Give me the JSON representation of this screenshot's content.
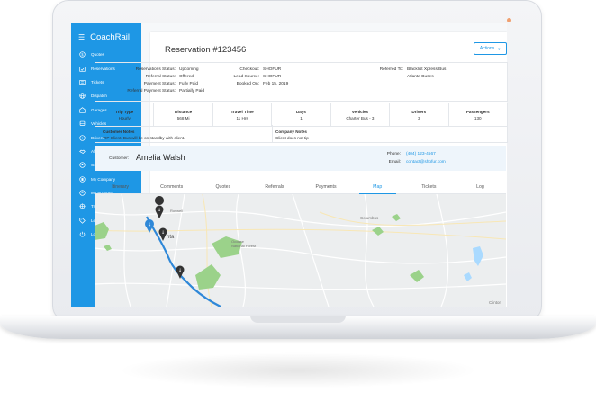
{
  "app": {
    "name": "CoachRail"
  },
  "sidebar": {
    "items": [
      {
        "label": "Quotes",
        "icon": "dollar-icon"
      },
      {
        "label": "Reservations",
        "icon": "calendar-check-icon"
      },
      {
        "label": "Tickets",
        "icon": "ticket-icon"
      },
      {
        "label": "Dispatch",
        "icon": "globe-icon"
      },
      {
        "label": "Garages",
        "icon": "garage-icon"
      },
      {
        "label": "Vehicles",
        "icon": "bus-icon"
      },
      {
        "label": "Drivers",
        "icon": "steering-wheel-icon"
      },
      {
        "label": "Affiliates",
        "icon": "handshake-icon"
      },
      {
        "label": "Customers",
        "icon": "user-circle-icon"
      },
      {
        "label": "My Company",
        "icon": "building-icon"
      },
      {
        "label": "My Account",
        "icon": "account-icon"
      },
      {
        "label": "Tracking",
        "icon": "crosshair-icon"
      },
      {
        "label": "Lead Feed",
        "icon": "tag-icon"
      },
      {
        "label": "Logout",
        "icon": "power-icon"
      }
    ]
  },
  "reservation": {
    "title": "Reservation #123456",
    "actions_label": "Actions",
    "info": {
      "status_label": "Reservations Status:",
      "status_value": "Upcoming",
      "referral_status_label": "Referral Status:",
      "referral_status_value": "Offered",
      "payment_status_label": "Payment Status:",
      "payment_status_value": "Fully Paid",
      "referral_payment_status_label": "Referral Payment Status:",
      "referral_payment_status_value": "Partially Paid",
      "checkout_label": "Checkout:",
      "checkout_value": "SHOFUR",
      "lead_source_label": "Lead Source:",
      "lead_source_value": "SHOFUR",
      "booked_on_label": "Booked On:",
      "booked_on_value": "Feb 15, 2019",
      "referred_to_label": "Referred To:",
      "referred_to_value_1": "Blacklist Xpress Bus",
      "referred_to_value_2": "Atlanta Buses"
    },
    "trip": [
      {
        "header": "Trip Type",
        "value": "Hourly"
      },
      {
        "header": "Distance",
        "value": "568 Mi"
      },
      {
        "header": "Travel Time",
        "value": "11 Hrs"
      },
      {
        "header": "Days",
        "value": "1"
      },
      {
        "header": "Vehicles",
        "value": "Charter Bus - 3"
      },
      {
        "header": "Drivers",
        "value": "3"
      },
      {
        "header": "Passengers",
        "value": "130"
      }
    ],
    "notes": {
      "customer_notes_label": "Customer Notes",
      "customer_notes_value": "VIP Client. Bus will be on standby with client.",
      "company_notes_label": "Company Notes",
      "company_notes_value": "Client does not tip"
    },
    "customer": {
      "label": "Customer:",
      "name": "Amelia Walsh",
      "phone_label": "Phone:",
      "phone": "(404) 123-4567",
      "email_label": "Email:",
      "email": "contact@shofur.com"
    },
    "tabs": [
      "Itinerary",
      "Comments",
      "Quotes",
      "Referrals",
      "Payments",
      "Map",
      "Tickets",
      "Log"
    ],
    "active_tab": "Map"
  },
  "map": {
    "labels": {
      "city": "nta",
      "roswell": "Roswell",
      "columbus": "Columbus",
      "oconee": "Oconee",
      "national_forest": "National Forest",
      "clinton": "Clinton"
    }
  },
  "colors": {
    "accent": "#1e97e5",
    "route": "#2f88d8",
    "park": "#9bd28a",
    "water": "#aadaff"
  }
}
